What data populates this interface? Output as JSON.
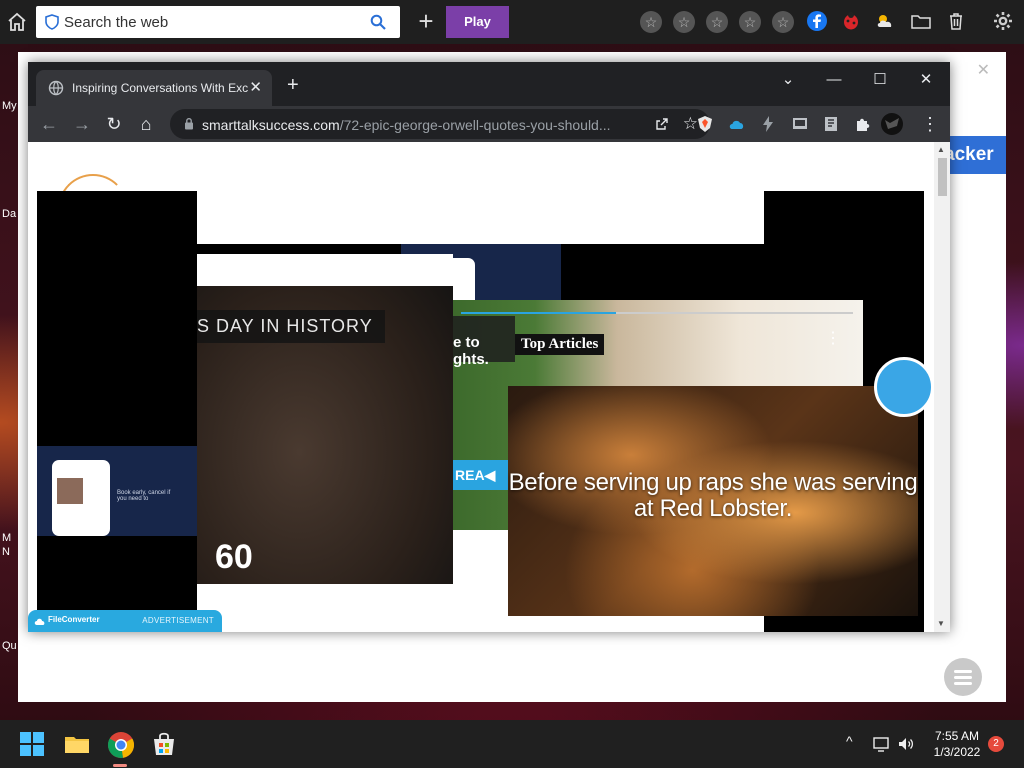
{
  "topbar": {
    "search_placeholder": "Search the web",
    "plus_label": "+",
    "play_label": "Play",
    "favorite_slots": [
      "☆",
      "☆",
      "☆",
      "☆",
      "☆"
    ],
    "play_color": "#7b3fa8"
  },
  "desktop": {
    "labels": [
      "My",
      "Da",
      "M",
      "N",
      "Qu"
    ]
  },
  "background_window": {
    "close_label": "✕",
    "button_label": "acker",
    "accent_color": "#2f6fd6"
  },
  "chrome": {
    "tab_title": "Inspiring Conversations With Exc",
    "tab_close": "✕",
    "new_tab": "+",
    "window_buttons": {
      "collapse": "⌄",
      "minimize": "—",
      "maximize": "☐",
      "close": "✕"
    },
    "nav": {
      "back": "←",
      "forward": "→",
      "reload": "↻",
      "home": "⌂"
    },
    "url_domain": "smarttalksuccess.com",
    "url_path": "/72-epic-george-orwell-quotes-you-should...",
    "bookmark": "☆",
    "menu": "⋮"
  },
  "page": {
    "video1": {
      "label": "S DAY IN HISTORY",
      "number": "60"
    },
    "video2": {
      "title": "Top Articles",
      "side_text_line1": "e to",
      "side_text_line2": "ghts.",
      "read_button": "REA◀",
      "menu_dots": "⋮"
    },
    "video3": {
      "quote": "Before serving up raps she was serving at Red Lobster."
    },
    "ad": {
      "brand": "FileConverter",
      "label": "ADVERTISEMENT"
    },
    "phone_text": "Book early, cancel if you need to"
  },
  "taskbar": {
    "time": "7:55 AM",
    "date": "1/3/2022",
    "notification_count": "2",
    "tray_chevron": "^"
  }
}
